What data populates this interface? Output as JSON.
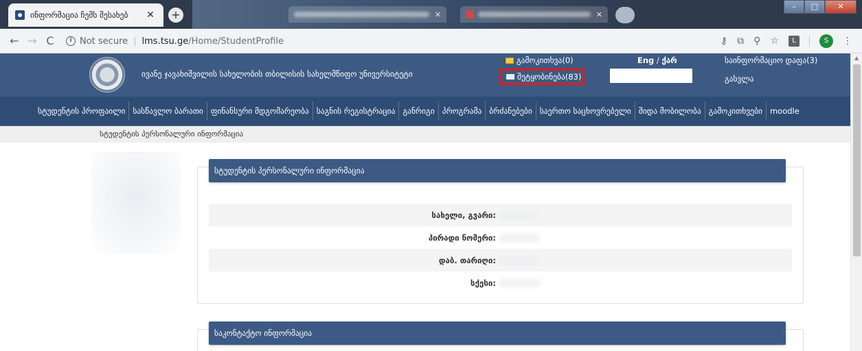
{
  "browser": {
    "active_tab_title": "ინფორმაცია ჩემს შესახებ",
    "address": {
      "security_label": "Not secure",
      "host": "lms.tsu.ge",
      "path": "/Home/StudentProfile"
    }
  },
  "header": {
    "university_name": "ივანე ჯავახიშვილის სახელობის თბილისის სახელმწიფო უნივერსიტეტი",
    "surveys_link": "გამოკითხვა(0)",
    "messages_link": "შეტყობინება(83)",
    "lang_en": "Eng",
    "lang_divider": "/",
    "lang_ka": "ქარ",
    "info_page_link": "საინფორმაციო დაფა(3)",
    "logout_link": "გასვლა"
  },
  "nav": {
    "items": [
      "სტუდენტის პროფაილი",
      "სასწავლო ბარათი",
      "ფინანსური მდგომარეობა",
      "საგნის რეგისტრაცია",
      "განრიგი",
      "პროგრამა",
      "ბრძანებები",
      "საერთო საცხოვრებელი",
      "შიდა მობილობა",
      "გამოკითხვები",
      "moodle"
    ]
  },
  "breadcrumb": "სტუდენტის პერსონალური ინფორმაცია",
  "personal_info": {
    "title": "სტუდენტის პერსონალური ინფორმაცია",
    "rows": [
      {
        "label": "სახელი, გვარი:"
      },
      {
        "label": "პირადი ნომერი:"
      },
      {
        "label": "დაბ. თარიღი:"
      },
      {
        "label": "სქესი:"
      }
    ]
  },
  "contact_info": {
    "title": "საკონტაქტო ინფორმაცია"
  },
  "colors": {
    "header_bg": "#3c5a83",
    "nav_bg": "#2e4c74",
    "highlight_border": "#e41b17"
  }
}
